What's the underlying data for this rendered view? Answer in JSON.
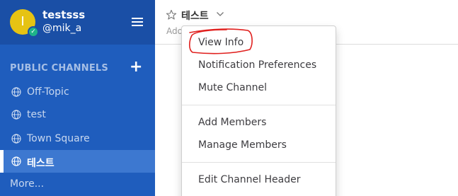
{
  "team": {
    "name": "testsss",
    "username": "@mik_a",
    "avatar_initial": "I",
    "avatar_color": "#e6c313",
    "status_color": "#1eb38a"
  },
  "sidebar": {
    "section_title": "PUBLIC CHANNELS",
    "add_icon": "+",
    "channels": [
      {
        "label": "Off-Topic",
        "icon": "globe-icon",
        "active": false
      },
      {
        "label": "test",
        "icon": "globe-icon",
        "active": false
      },
      {
        "label": "Town Square",
        "icon": "globe-icon",
        "active": false
      },
      {
        "label": "테스트",
        "icon": "globe-icon",
        "active": true
      }
    ],
    "more_label": "More...",
    "bg_color": "#1f5dbd"
  },
  "header": {
    "title": "테스트",
    "purpose_partial": "Ado"
  },
  "dropdown": {
    "items": [
      "View Info",
      "Notification Preferences",
      "Mute Channel",
      "Add Members",
      "Manage Members",
      "Edit Channel Header"
    ]
  },
  "annotation": {
    "color": "#e0201e"
  }
}
